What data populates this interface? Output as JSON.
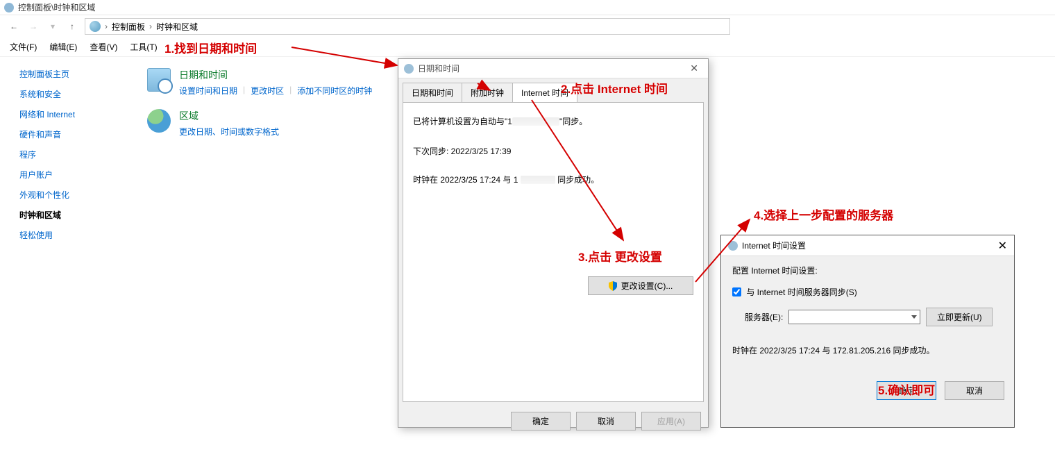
{
  "window": {
    "title": "控制面板\\时钟和区域"
  },
  "nav": {
    "root": "控制面板",
    "section": "时钟和区域"
  },
  "menu": {
    "file": "文件(F)",
    "edit": "编辑(E)",
    "view": "查看(V)",
    "tools": "工具(T)"
  },
  "sidebar": {
    "home": "控制面板主页",
    "security": "系统和安全",
    "network": "网络和 Internet",
    "hardware": "硬件和声音",
    "programs": "程序",
    "accounts": "用户账户",
    "appearance": "外观和个性化",
    "clock": "时钟和区域",
    "ease": "轻松使用"
  },
  "content": {
    "datetime": {
      "title": "日期和时间",
      "link1": "设置时间和日期",
      "link2": "更改时区",
      "link3": "添加不同时区的时钟"
    },
    "region": {
      "title": "区域",
      "link1": "更改日期、时间或数字格式"
    }
  },
  "dlg1": {
    "title": "日期和时间",
    "tab1": "日期和时间",
    "tab2": "附加时钟",
    "tab3": "Internet 时间",
    "sync_prefix": "已将计算机设置为自动与\"1",
    "sync_suffix": "\"同步。",
    "next_sync": "下次同步: 2022/3/25 17:39",
    "last_prefix": "时钟在 2022/3/25 17:24 与 1",
    "last_suffix": "同步成功。",
    "change": "更改设置(C)...",
    "ok": "确定",
    "cancel": "取消",
    "apply": "应用(A)"
  },
  "dlg2": {
    "title": "Internet 时间设置",
    "heading": "配置 Internet 时间设置:",
    "checkbox": "与 Internet 时间服务器同步(S)",
    "server_label": "服务器(E):",
    "update_now": "立即更新(U)",
    "status": "时钟在 2022/3/25 17:24 与 172.81.205.216 同步成功。",
    "ok": "确定",
    "cancel": "取消"
  },
  "annotations": {
    "a1": "1.找到日期和时间",
    "a2": "2.点击 Internet 时间",
    "a3": "3.点击 更改设置",
    "a4": "4.选择上一步配置的服务器",
    "a5": "5.确认即可"
  }
}
